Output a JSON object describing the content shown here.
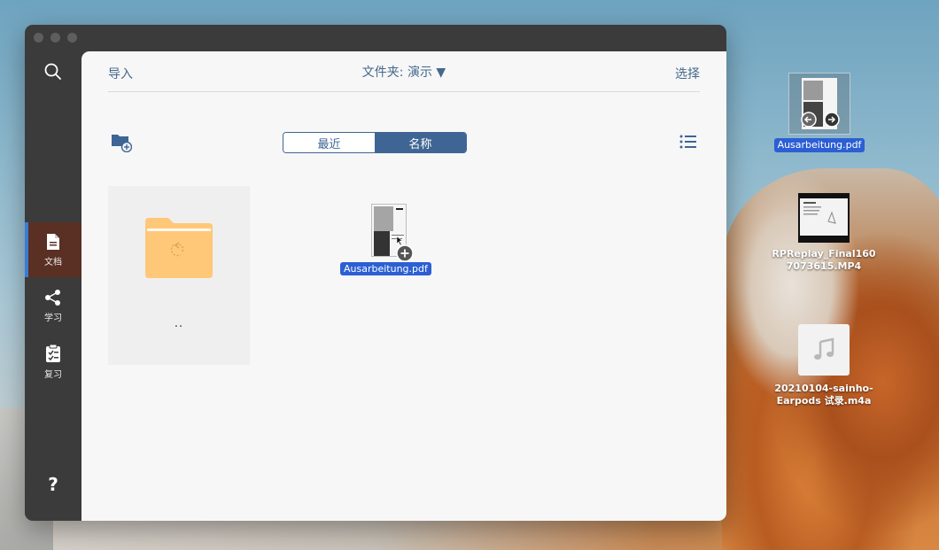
{
  "sidebar": {
    "items": [
      {
        "label": "文档"
      },
      {
        "label": "学习"
      },
      {
        "label": "复习"
      }
    ],
    "help": "?",
    "more": "..."
  },
  "toolbar": {
    "import_label": "导入",
    "folder_label": "文件夹: 演示 ▼",
    "select_label": "选择"
  },
  "sort": {
    "options": [
      "最近",
      "名称"
    ],
    "selected": "名称"
  },
  "grid": {
    "parent_label": "..",
    "file_name": "Ausarbeitung.pdf"
  },
  "desktop": {
    "files": [
      {
        "name": "Ausarbeitung.pdf"
      },
      {
        "name_line1": "RPReplay_Final160",
        "name_line2": "7073615.MP4"
      },
      {
        "name_line1": "20210104-sainho-",
        "name_line2": "Earpods 试录.m4a"
      }
    ]
  },
  "colors": {
    "accent": "#3f6594",
    "active_nav": "#5a2f24",
    "selection": "#2c5fd3",
    "folder": "#ffc878"
  }
}
